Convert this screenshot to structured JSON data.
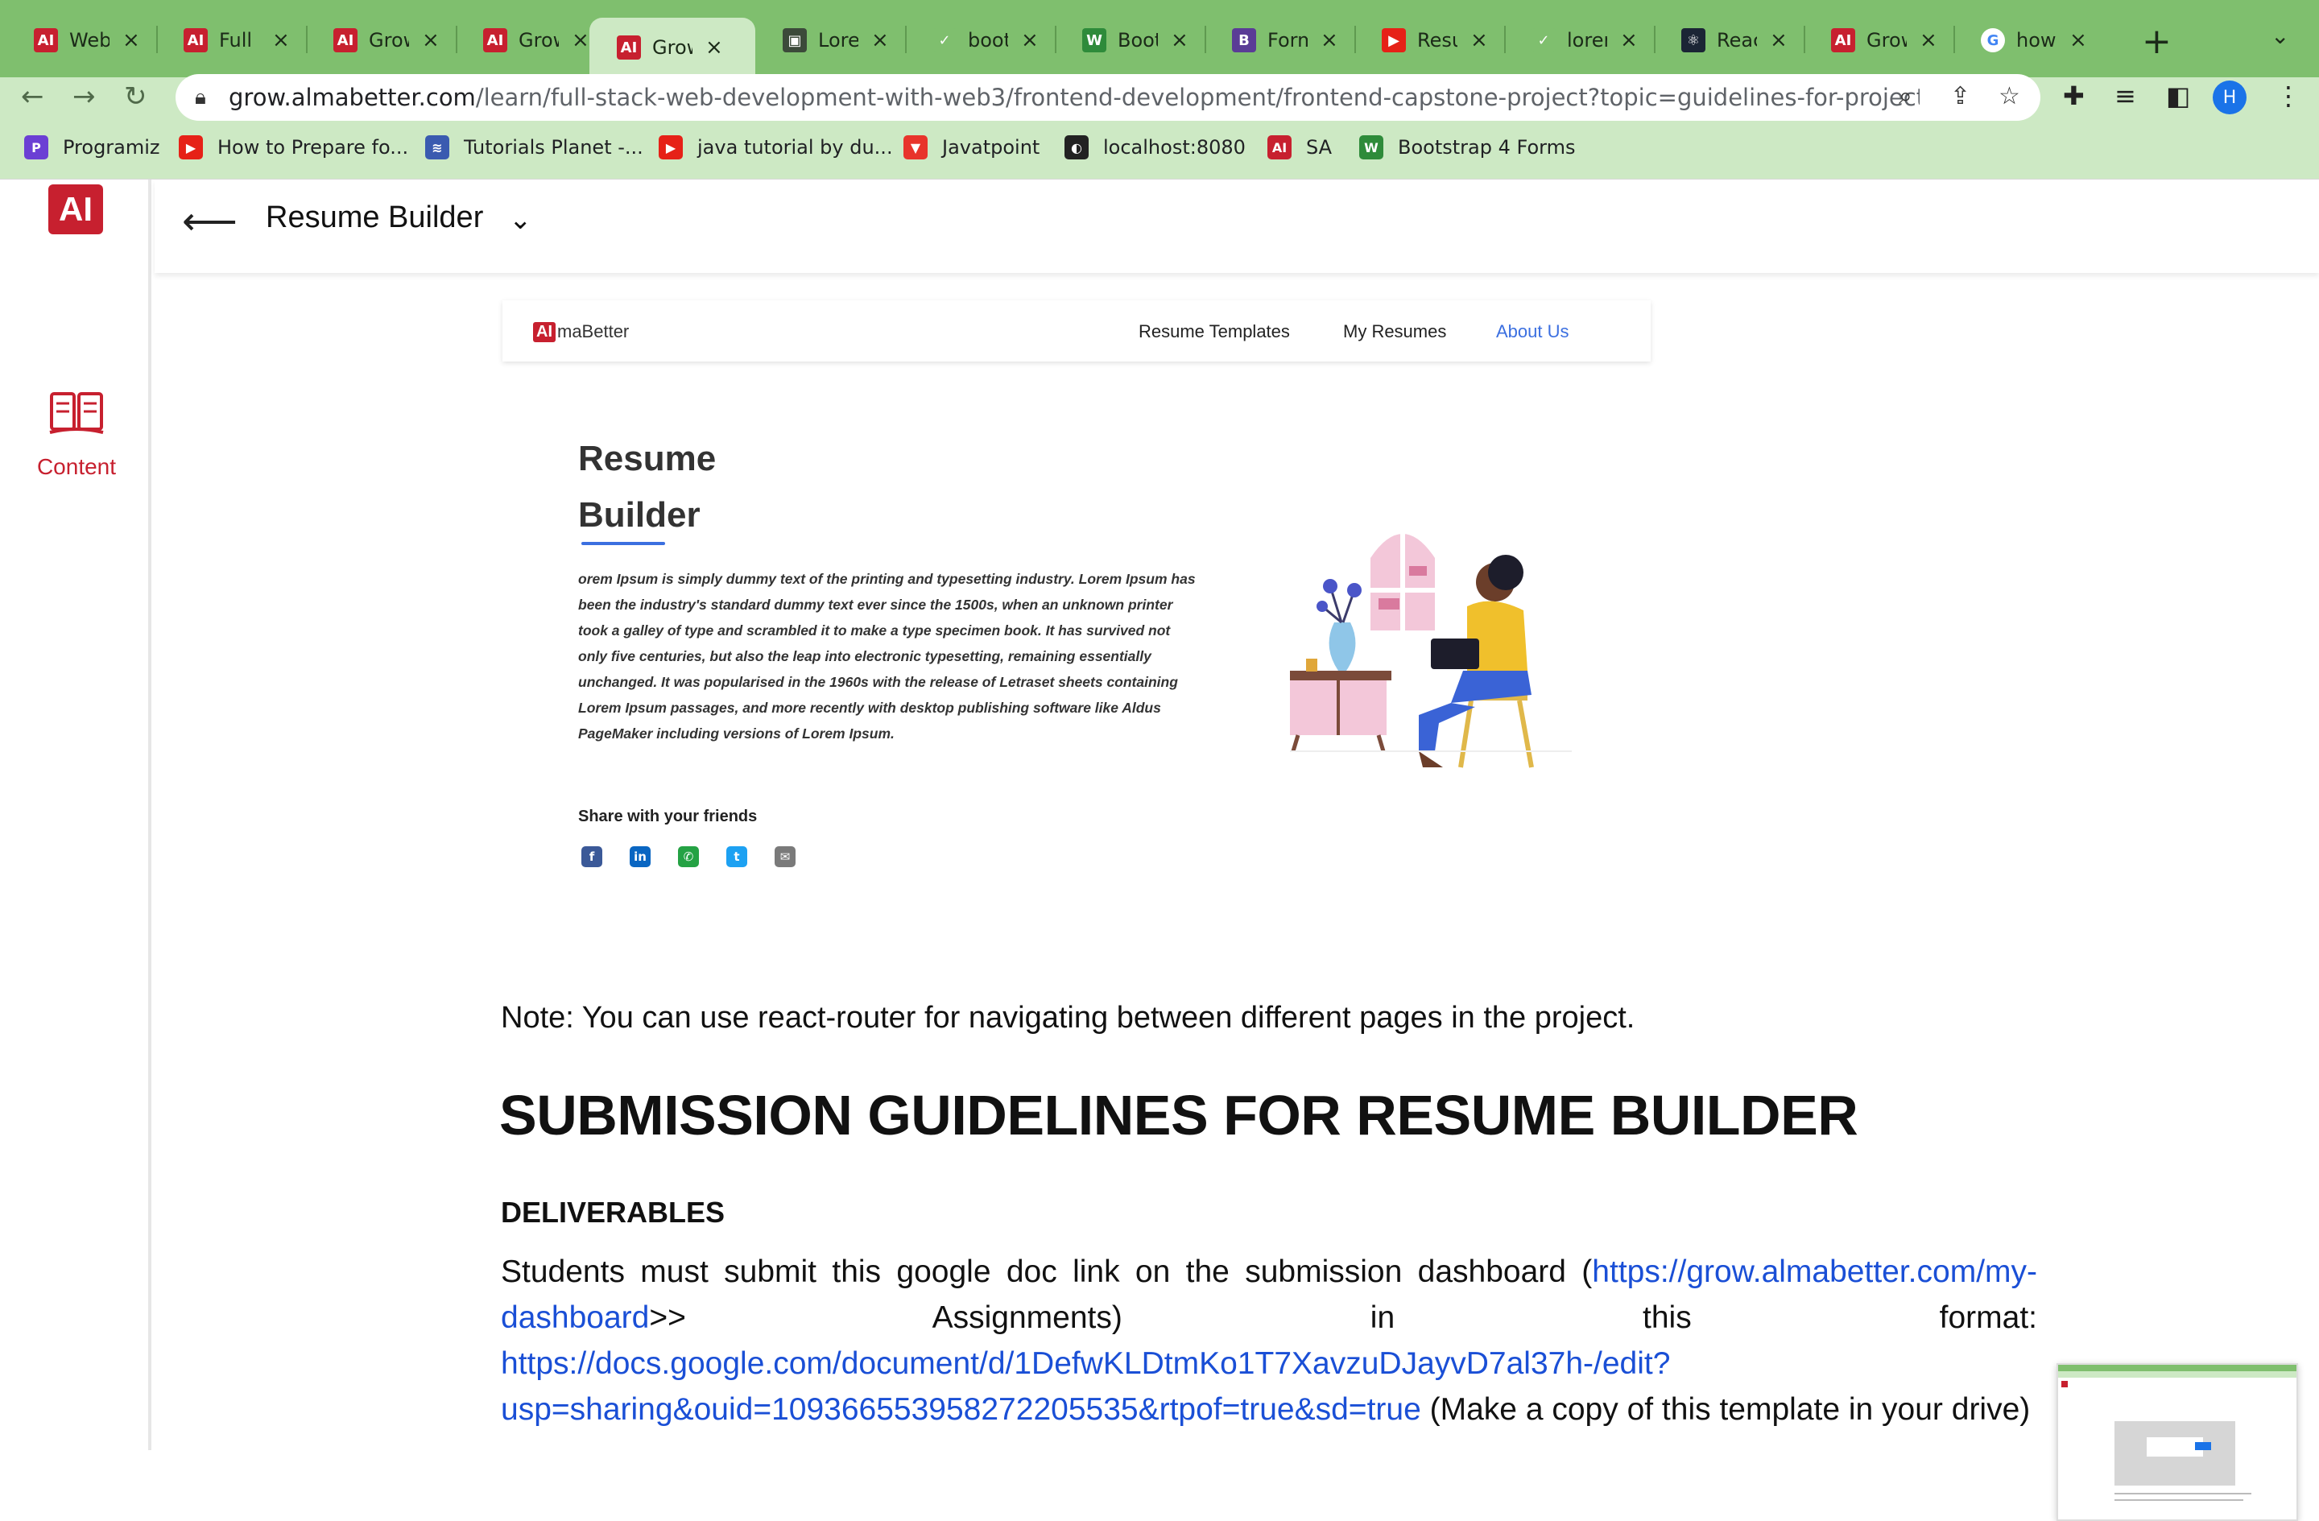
{
  "browser": {
    "tabs": [
      {
        "title": "Web",
        "favicon": "almabetter-icon",
        "fav_text": "AI",
        "fav_color": "#c7202f"
      },
      {
        "title": "Full S",
        "favicon": "almabetter-icon",
        "fav_text": "AI",
        "fav_color": "#c7202f"
      },
      {
        "title": "Grow",
        "favicon": "almabetter-icon",
        "fav_text": "AI",
        "fav_color": "#c7202f"
      },
      {
        "title": "Grow",
        "favicon": "almabetter-icon",
        "fav_text": "AI",
        "fav_color": "#c7202f"
      },
      {
        "title": "Grow",
        "favicon": "almabetter-icon",
        "fav_text": "AI",
        "fav_color": "#c7202f",
        "active": true
      },
      {
        "title": "Lorem",
        "favicon": "image-icon",
        "fav_text": "▣",
        "fav_color": "#3c4a3a"
      },
      {
        "title": "boots",
        "favicon": "tutorials-icon",
        "fav_text": "✓",
        "fav_color": "#7fbf6e"
      },
      {
        "title": "Boots",
        "favicon": "w3-icon",
        "fav_text": "W",
        "fav_color": "#2e8b3a"
      },
      {
        "title": "Form",
        "favicon": "bootstrap-icon",
        "fav_text": "B",
        "fav_color": "#5a3c96"
      },
      {
        "title": "Resu",
        "favicon": "youtube-icon",
        "fav_text": "▶",
        "fav_color": "#e62117"
      },
      {
        "title": "lorem",
        "favicon": "tutorials-icon",
        "fav_text": "✓",
        "fav_color": "#7fbf6e"
      },
      {
        "title": "Reac",
        "favicon": "react-icon",
        "fav_text": "⚛",
        "fav_color": "#1b2535"
      },
      {
        "title": "Grow",
        "favicon": "almabetter-icon",
        "fav_text": "AI",
        "fav_color": "#c7202f"
      },
      {
        "title": "how",
        "favicon": "google-icon",
        "fav_text": "G",
        "fav_color": "#ffffff"
      }
    ],
    "new_tab_symbol": "+",
    "tab_menu_symbol": "⌄",
    "url_host": "grow.almabetter.com",
    "url_path": "/learn/full-stack-web-development-with-web3/frontend-development/frontend-capstone-project?topic=guidelines-for-project-flash...",
    "profile_initial": "H",
    "bookmarks": [
      {
        "label": "Programiz",
        "icon": "programiz-icon",
        "icon_text": "P",
        "color": "#6b3fd4"
      },
      {
        "label": "How to Prepare fo...",
        "icon": "youtube-icon",
        "icon_text": "▶",
        "color": "#e62117"
      },
      {
        "label": "Tutorials Planet -...",
        "icon": "tutorials-planet-icon",
        "icon_text": "≋",
        "color": "#3a5bb0"
      },
      {
        "label": "java tutorial by du...",
        "icon": "youtube-icon",
        "icon_text": "▶",
        "color": "#e62117"
      },
      {
        "label": "Javatpoint",
        "icon": "javatpoint-icon",
        "icon_text": "▼",
        "color": "#e8342b"
      },
      {
        "label": "localhost:8080",
        "icon": "globe-icon",
        "icon_text": "◐",
        "color": "#222222"
      },
      {
        "label": "SA",
        "icon": "almabetter-icon",
        "icon_text": "AI",
        "color": "#c7202f"
      },
      {
        "label": "Bootstrap 4 Forms",
        "icon": "w3-icon",
        "icon_text": "W",
        "color": "#2e8b3a"
      }
    ]
  },
  "sidebar": {
    "logo_text": "AI",
    "content_label": "Content"
  },
  "topbar": {
    "title": "Resume Builder"
  },
  "preview": {
    "logo_mark": "AI",
    "logo_name": "maBetter",
    "nav": [
      "Resume Templates",
      "My Resumes",
      "About Us"
    ],
    "heading_line1": "Resume",
    "heading_line2": "Builder",
    "paragraph": "orem Ipsum is simply dummy text of the printing and typesetting industry. Lorem Ipsum has been the industry's standard dummy text ever since the 1500s, when an unknown printer took a galley of type and scrambled it to make a type specimen book. It has survived not only five centuries, but also the leap into electronic typesetting, remaining essentially unchanged. It was popularised in the 1960s with the release of Letraset sheets containing Lorem Ipsum passages, and more recently with desktop publishing software like Aldus PageMaker including versions of Lorem Ipsum.",
    "share_label": "Share with your friends",
    "socials": [
      {
        "name": "facebook-icon",
        "text": "f",
        "color": "#3b5998"
      },
      {
        "name": "linkedin-icon",
        "text": "in",
        "color": "#0a66c2"
      },
      {
        "name": "whatsapp-icon",
        "text": "✆",
        "color": "#25a244"
      },
      {
        "name": "twitter-icon",
        "text": "t",
        "color": "#1da1f2"
      },
      {
        "name": "email-icon",
        "text": "✉",
        "color": "#7a7a7a"
      }
    ]
  },
  "article": {
    "note": "Note: You can use react-router for navigating between different pages in the project.",
    "heading": "SUBMISSION GUIDELINES FOR RESUME BUILDER",
    "subheading": "DELIVERABLES",
    "body_1": "Students must submit this google doc link on the submission dashboard (",
    "link_1": "https://grow.almabetter.com/my-dashboard",
    "body_2": ">> Assignments) in this format: ",
    "link_2": "https://docs.google.com/document/d/1DefwKLDtmKo1T7XavzuDJayvD7al37h-/edit?usp=sharing&ouid=109366553958272205535&rtpof=true&sd=true",
    "body_3": " (Make a copy of this template in your drive)"
  },
  "colors": {
    "tab_strip": "#7fbf6e",
    "toolbar": "#cde9c4",
    "brand_red": "#c7202f",
    "link_blue": "#1a4fd6"
  }
}
